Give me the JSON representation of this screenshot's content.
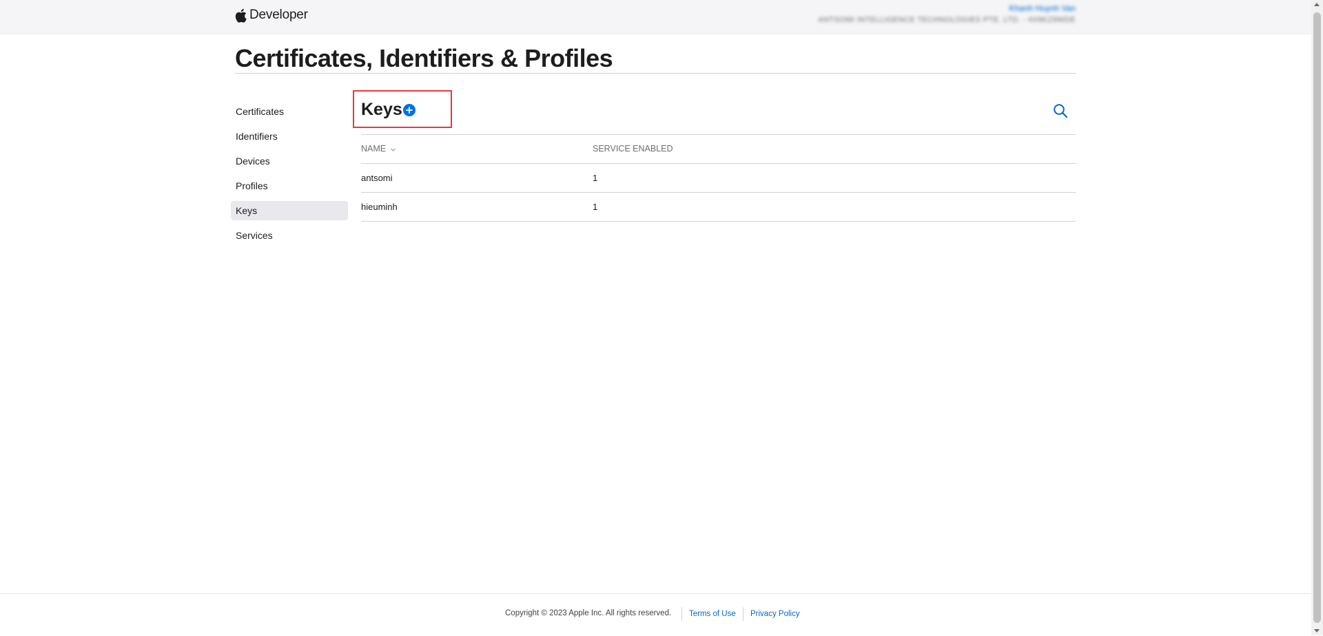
{
  "header": {
    "brand": "Developer",
    "logo_icon": "apple-logo-icon",
    "account_name": "Khanh Huynh Van",
    "account_team": "ANTSOMI INTELLIGENCE TECHNOLOGIES PTE. LTD. - 4X8KZ9WDE"
  },
  "page": {
    "title": "Certificates, Identifiers & Profiles"
  },
  "sidebar": {
    "items": [
      {
        "label": "Certificates"
      },
      {
        "label": "Identifiers"
      },
      {
        "label": "Devices"
      },
      {
        "label": "Profiles"
      },
      {
        "label": "Keys",
        "active": true
      },
      {
        "label": "Services"
      }
    ]
  },
  "section": {
    "title": "Keys",
    "add_icon": "plus-circle-icon",
    "search_icon": "search-icon",
    "highlight_color": "#e8383d"
  },
  "table": {
    "columns": [
      "NAME",
      "SERVICE ENABLED"
    ],
    "sort_icon": "chevron-down-icon",
    "rows": [
      {
        "name": "antsomi",
        "service_enabled": "1"
      },
      {
        "name": "hieuminh",
        "service_enabled": "1"
      }
    ]
  },
  "footer": {
    "copyright": "Copyright © 2023 Apple Inc. All rights reserved.",
    "links": [
      "Terms of Use",
      "Privacy Policy"
    ]
  },
  "colors": {
    "accent": "#0071e3",
    "link": "#0066cc",
    "text": "#1d1d1f"
  }
}
